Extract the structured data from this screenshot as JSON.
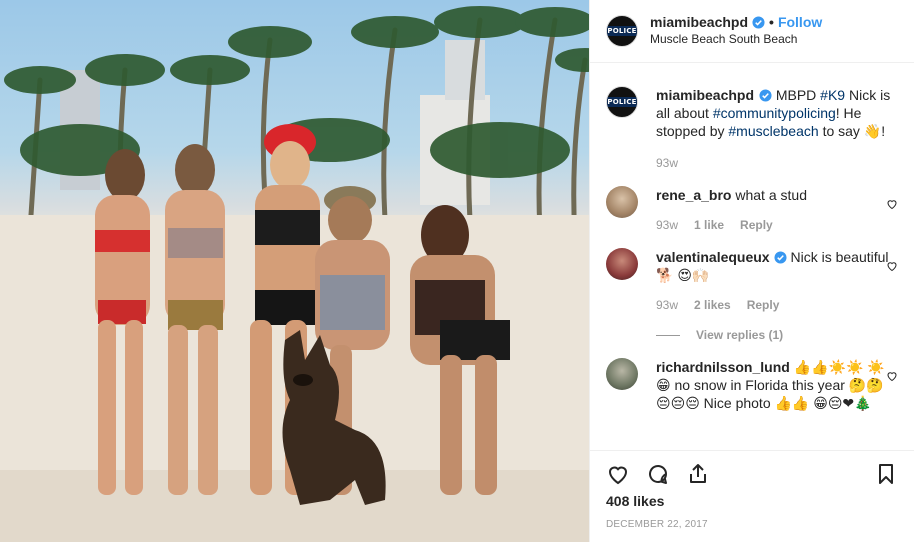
{
  "post": {
    "username": "miamibeachpd",
    "avatar_label": "POLICE",
    "follow_label": "Follow",
    "dot": "•",
    "location": "Muscle Beach South Beach",
    "image_alt": "Five women in swimsuits posing with a German shepherd K9 dog on the beach with palm trees"
  },
  "caption": {
    "username": "miamibeachpd",
    "text_parts": [
      "MBPD",
      "#K9",
      "Nick is all about",
      "#communitypolicing",
      "! He stopped by",
      "#musclebeach",
      "to say",
      "👋",
      "!"
    ],
    "age": "93w"
  },
  "comments": [
    {
      "username": "rene_a_bro",
      "text": "what a stud",
      "age": "93w",
      "likes": "1 like",
      "reply": "Reply",
      "verified": false
    },
    {
      "username": "valentinalequeux",
      "text": "Nick is beautiful 🐕 😍🙌🏻",
      "age": "93w",
      "likes": "2 likes",
      "reply": "Reply",
      "view_replies": "View replies (1)",
      "verified": true
    },
    {
      "username": "richardnilsson_lund",
      "text": "👍👍☀️☀️ ☀️😁 no snow in Florida this year 🤔🤔😔😔😔 Nice photo 👍👍 😁😔❤🎄",
      "verified": false
    }
  ],
  "actions": {
    "likes": "408 likes",
    "date": "DECEMBER 22, 2017"
  },
  "colors": {
    "link": "#003569",
    "follow": "#3897f0",
    "muted": "#999999",
    "text": "#262626"
  },
  "icons": [
    "heart-icon",
    "comment-icon",
    "share-icon",
    "bookmark-icon",
    "verified-badge-icon"
  ]
}
